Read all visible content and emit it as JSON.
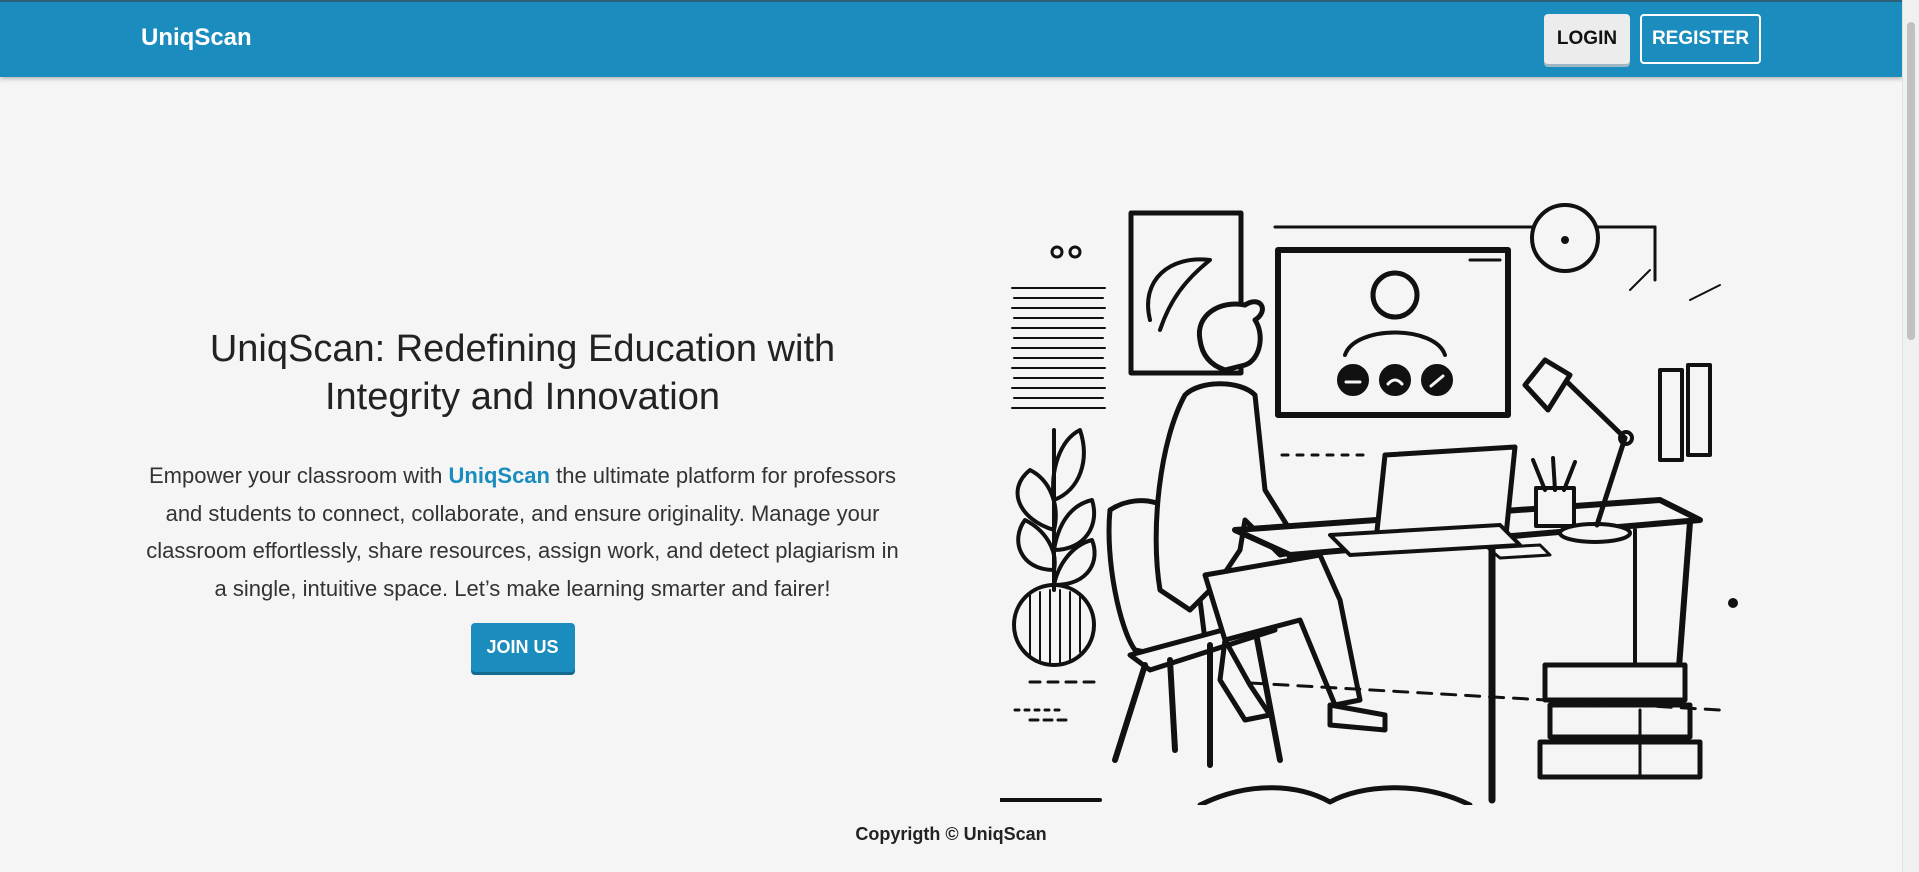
{
  "navbar": {
    "brand": "UniqScan",
    "login_label": "LOGIN",
    "register_label": "REGISTER"
  },
  "hero": {
    "title": "UniqScan: Redefining Education with Integrity and Innovation",
    "text_before": "Empower your classroom with ",
    "text_brand": "UniqScan",
    "text_after": " the ultimate platform for professors and students to connect, collaborate, and ensure originality. Manage your classroom effortlessly, share resources, assign work, and detect plagiarism in a single, intuitive space. Let’s make learning smarter and fairer!",
    "cta_label": "JOIN US"
  },
  "footer": {
    "text": "Copyrigth © UniqScan"
  },
  "colors": {
    "primary": "#1a8dbe",
    "background": "#f5f5f5"
  },
  "icons": {
    "illustration": "student-at-desk-video-call-illustration"
  }
}
